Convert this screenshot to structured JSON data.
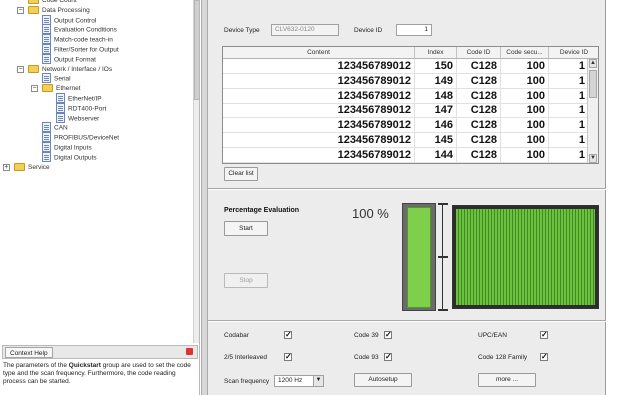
{
  "tree": {
    "items": [
      {
        "label": "Code Count",
        "level": 1,
        "icon": "folder-icon",
        "expander": ""
      },
      {
        "label": "Data Processing",
        "level": 1,
        "icon": "folder-icon",
        "expander": "−"
      },
      {
        "label": "Output Control",
        "level": 2,
        "icon": "document-icon",
        "expander": ""
      },
      {
        "label": "Evaluation Conditions",
        "level": 2,
        "icon": "document-icon",
        "expander": ""
      },
      {
        "label": "Match-code teach-in",
        "level": 2,
        "icon": "document-icon",
        "expander": ""
      },
      {
        "label": "Filter/Sorter for Output",
        "level": 2,
        "icon": "document-icon",
        "expander": ""
      },
      {
        "label": "Output Format",
        "level": 2,
        "icon": "document-icon",
        "expander": ""
      },
      {
        "label": "Network / Interface / IOs",
        "level": 1,
        "icon": "folder-icon",
        "expander": "−"
      },
      {
        "label": "Serial",
        "level": 2,
        "icon": "document-icon",
        "expander": ""
      },
      {
        "label": "Ethernet",
        "level": 2,
        "icon": "folder-icon",
        "expander": "−"
      },
      {
        "label": "EtherNet/IP",
        "level": 3,
        "icon": "document-icon",
        "expander": ""
      },
      {
        "label": "RDT400-Port",
        "level": 3,
        "icon": "document-icon",
        "expander": ""
      },
      {
        "label": "Webserver",
        "level": 3,
        "icon": "document-icon",
        "expander": ""
      },
      {
        "label": "CAN",
        "level": 2,
        "icon": "document-icon",
        "expander": ""
      },
      {
        "label": "PROFIBUS/DeviceNet",
        "level": 2,
        "icon": "document-icon",
        "expander": ""
      },
      {
        "label": "Digital Inputs",
        "level": 2,
        "icon": "document-icon",
        "expander": ""
      },
      {
        "label": "Digital Outputs",
        "level": 2,
        "icon": "document-icon",
        "expander": ""
      },
      {
        "label": "Service",
        "level": 0,
        "icon": "folder-icon",
        "expander": "+"
      }
    ]
  },
  "context_help": {
    "tab_label": "Context Help",
    "text_before": "The parameters of the ",
    "text_bold": "Quickstart",
    "text_after": " group are used to set the code type and the scan frequency. Furthermore, the code reading process can be started."
  },
  "device": {
    "type_label": "Device Type",
    "type_value": "CLV632-0120",
    "id_label": "Device ID",
    "id_value": "1"
  },
  "table": {
    "columns": [
      "Content",
      "Index",
      "Code ID",
      "Code secu...",
      "Device ID"
    ],
    "rows": [
      [
        "123456789012",
        "150",
        "C128",
        "100",
        "1"
      ],
      [
        "123456789012",
        "149",
        "C128",
        "100",
        "1"
      ],
      [
        "123456789012",
        "148",
        "C128",
        "100",
        "1"
      ],
      [
        "123456789012",
        "147",
        "C128",
        "100",
        "1"
      ],
      [
        "123456789012",
        "146",
        "C128",
        "100",
        "1"
      ],
      [
        "123456789012",
        "145",
        "C128",
        "100",
        "1"
      ],
      [
        "123456789012",
        "144",
        "C128",
        "100",
        "1"
      ]
    ]
  },
  "buttons": {
    "clear_list": "Clear list",
    "start": "Start",
    "stop": "Stop",
    "autosetup": "Autosetup",
    "more": "more ..."
  },
  "percentage": {
    "title": "Percentage Evaluation",
    "value_text": "100 %",
    "fill_fraction": 1.0,
    "bar_color": "#7ed04a"
  },
  "codes": {
    "codabar": {
      "label": "Codabar",
      "checked": true
    },
    "code39": {
      "label": "Code 39",
      "checked": true
    },
    "upc_ean": {
      "label": "UPC/EAN",
      "checked": true
    },
    "i2of5": {
      "label": "2/5 Interleaved",
      "checked": true
    },
    "code93": {
      "label": "Code 93",
      "checked": true
    },
    "code128": {
      "label": "Code 128 Family",
      "checked": true
    }
  },
  "scan": {
    "label": "Scan frequency",
    "value": "1200 Hz"
  }
}
